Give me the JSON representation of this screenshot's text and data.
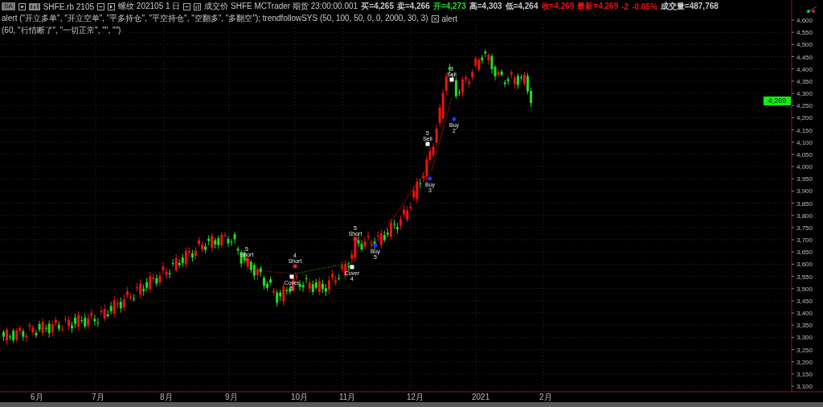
{
  "toolbar": {
    "symbol_button": "SA",
    "symbol": "SHFE.rb 2105",
    "series": "螺纹 202105 1 日",
    "source": "成交价 SHFE MCTrader 期货 23:00:00.001"
  },
  "quotes": [
    {
      "text": "买=4,265",
      "color": "#c8c8c8"
    },
    {
      "text": "卖=4,266",
      "color": "#c8c8c8"
    },
    {
      "text": "开=4,273",
      "color": "#22dd22"
    },
    {
      "text": "高=4,303",
      "color": "#c8c8c8"
    },
    {
      "text": "低=4,264",
      "color": "#c8c8c8"
    },
    {
      "text": "收=4,269",
      "color": "#ee1111"
    },
    {
      "text": "最新=4,269",
      "color": "#ee1111"
    },
    {
      "text": "-2",
      "color": "#ee1111"
    },
    {
      "text": "-0.05%",
      "color": "#ee1111"
    },
    {
      "text": "成交量=487,768",
      "color": "#c8c8c8"
    }
  ],
  "study": "alert (\"开立多单\", \"开立空单\", \"平多持仓\", \"平空持仓\", \"空翻多\", \"多翻空\"); trendfollowSYS (50, 100, 50, 0, 0, 2000, 30, 3)",
  "alert_label": "alert",
  "alert_args": "(60, \"行情断了\", \"一切正常\", \"\", \"\")",
  "price_axis": [
    "4,600",
    "4,550",
    "4,500",
    "4,450",
    "4,400",
    "4,350",
    "4,300",
    "4,250",
    "4,200",
    "4,150",
    "4,100",
    "4,050",
    "4,000",
    "3,950",
    "3,900",
    "3,850",
    "3,800",
    "3,750",
    "3,700",
    "3,650",
    "3,600",
    "3,550",
    "3,500",
    "3,450",
    "3,400",
    "3,350",
    "3,300",
    "3,250",
    "3,200",
    "3,150",
    "3,100"
  ],
  "last_price": "4,269",
  "time_axis": [
    "6月",
    "7月",
    "8月",
    "9月",
    "10月",
    "11月",
    "12月",
    "2021",
    "2月"
  ],
  "signals": [
    {
      "kind": "short",
      "count": "5",
      "label": "Short"
    },
    {
      "kind": "short",
      "count": "4",
      "label": "Short"
    },
    {
      "kind": "cover",
      "count": "5",
      "label": "Cover"
    },
    {
      "kind": "short",
      "count": "5",
      "label": "Short"
    },
    {
      "kind": "cover",
      "count": "4",
      "label": "Cover"
    },
    {
      "kind": "buy",
      "count": "5",
      "label": "Buy"
    },
    {
      "kind": "sell",
      "count": "5",
      "label": "Sell"
    },
    {
      "kind": "buy",
      "count": "3",
      "label": "Buy"
    },
    {
      "kind": "sell",
      "count": "3",
      "label": "Sell"
    },
    {
      "kind": "buy",
      "count": "2",
      "label": "Buy"
    }
  ]
}
